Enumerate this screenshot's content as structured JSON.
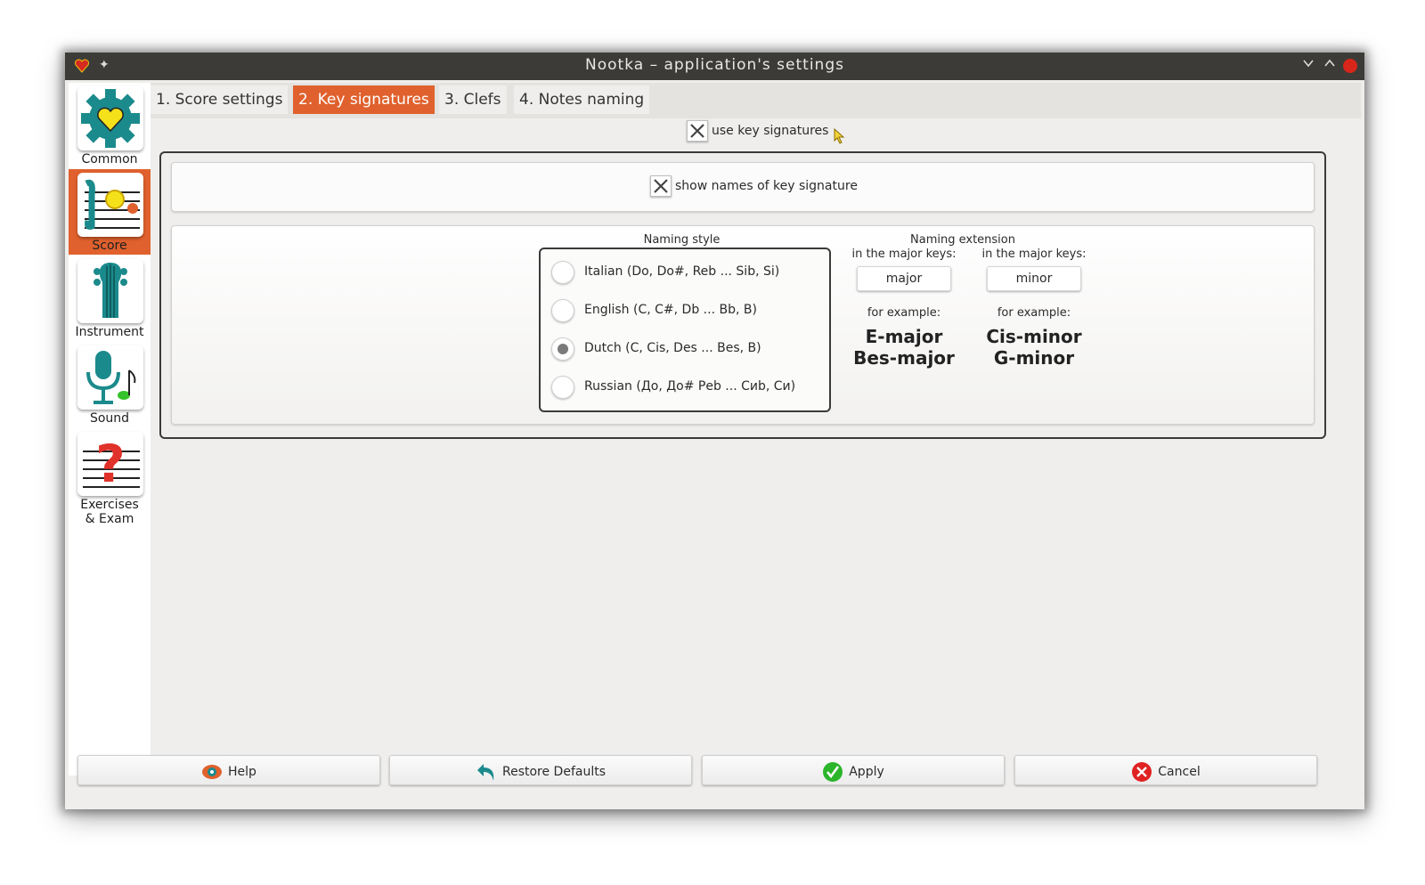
{
  "window": {
    "title": "Nootka – application's settings"
  },
  "titlebar": {
    "app_icon": "heart-icon",
    "pin_icon": "pin-icon",
    "minimize_icon": "chevron-down-icon",
    "maximize_icon": "chevron-up-icon",
    "close_icon": "close-icon"
  },
  "sidebar": {
    "items": [
      {
        "label": "Common",
        "icon": "gear-heart-icon"
      },
      {
        "label": "Score",
        "icon": "score-icon"
      },
      {
        "label": "Instrument",
        "icon": "guitar-icon"
      },
      {
        "label": "Sound",
        "icon": "microphone-icon"
      },
      {
        "label": "Exercises",
        "label2": "& Exam",
        "icon": "question-staff-icon"
      }
    ],
    "active": "Score",
    "active_color": "#e0612d"
  },
  "tabs": [
    {
      "label": "1. Score settings"
    },
    {
      "label": "2. Key signatures"
    },
    {
      "label": "3. Clefs"
    },
    {
      "label": "4. Notes naming"
    }
  ],
  "active_tab": "2. Key signatures",
  "use_key_signatures": {
    "label": "use key signatures",
    "checked": true
  },
  "show_names": {
    "label": "show names of key signature",
    "checked": true
  },
  "naming_style": {
    "title": "Naming style",
    "options": [
      {
        "label": "Italian (Do, Do#, Reb ... Sib, Si)",
        "selected": false
      },
      {
        "label": "English (C, C#, Db ... Bb, B)",
        "selected": false
      },
      {
        "label": "Dutch (C, Cis, Des ... Bes, B)",
        "selected": true
      },
      {
        "label": "Russian (До, До# Реb ... Сиb, Си)",
        "selected": false
      }
    ]
  },
  "naming_extension": {
    "title": "Naming extension",
    "major": {
      "caption": "in the major keys:",
      "value": "major",
      "example_caption": "for example:",
      "examples": [
        "E-major",
        "Bes-major"
      ]
    },
    "minor": {
      "caption": "in the major keys:",
      "value": "minor",
      "example_caption": "for example:",
      "examples": [
        "Cis-minor",
        "G-minor"
      ]
    }
  },
  "buttons": {
    "help": {
      "label": "Help",
      "icon": "help-icon"
    },
    "restore": {
      "label": "Restore Defaults",
      "icon": "undo-arrow-icon"
    },
    "apply": {
      "label": "Apply",
      "icon": "checkmark-icon"
    },
    "cancel": {
      "label": "Cancel",
      "icon": "cancel-icon"
    }
  }
}
